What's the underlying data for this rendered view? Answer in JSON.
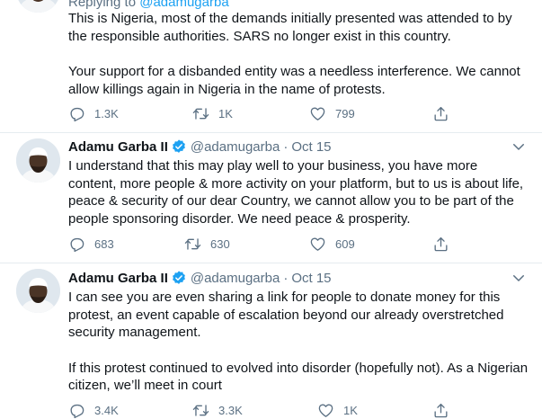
{
  "tweet1": {
    "replying_prefix": "Replying to",
    "replying_handle": "@adamugarba",
    "paragraph1": "This is Nigeria, most of the demands initially presented was attended to by the responsible authorities. SARS no longer exist in this country.",
    "paragraph2": "Your support for a disbanded entity was a needless interference. We cannot allow killings again in Nigeria in the name of protests.",
    "replies": "1.3K",
    "retweets": "1K",
    "likes": "799"
  },
  "tweet2": {
    "name": "Adamu Garba II",
    "handle": "@adamugarba",
    "separator": "·",
    "date": "Oct 15",
    "paragraph1": "I understand that this may play well to your business, you have more content, more people & more activity on your platform, but to us is about life, peace & security of our dear Country, we cannot allow you to be part of the people sponsoring disorder. We need peace & prosperity.",
    "replies": "683",
    "retweets": "630",
    "likes": "609"
  },
  "tweet3": {
    "name": "Adamu Garba II",
    "handle": "@adamugarba",
    "separator": "·",
    "date": "Oct 15",
    "paragraph1": "I can see you are even sharing a link for people to donate money for this protest, an event capable of escalation beyond our already overstretched security management.",
    "paragraph2": "If this protest continued to evolved into disorder (hopefully not). As a Nigerian citizen, we’ll meet in court",
    "replies": "3.4K",
    "retweets": "3.3K",
    "likes": "1K"
  },
  "colors": {
    "accent": "#1da1f2",
    "muted": "#5b7083",
    "separator": "#e6ecf0"
  },
  "icons": {
    "reply": "reply-icon",
    "retweet": "retweet-icon",
    "like": "heart-icon",
    "share": "share-icon",
    "verified": "verified-badge-icon",
    "more": "chevron-down-icon"
  }
}
